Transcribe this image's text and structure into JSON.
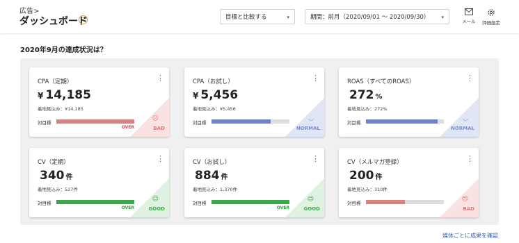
{
  "header": {
    "breadcrumb": "広告>",
    "title": "ダッシュボード",
    "help_icon": "?",
    "compare_select": "目標と比較する",
    "period_select": "期間：前月（2020/09/01 ～ 2020/09/30）",
    "select_arrow": "▾",
    "mail_label": "メール",
    "settings_label": "評価設定"
  },
  "section_title": "2020年9月の達成状況は？",
  "menu_glyph": "⋮",
  "target_label": "対目標",
  "cards": [
    {
      "title": "CPA（定期）",
      "prefix": "¥",
      "value": "14,185",
      "unit": "",
      "forecast": "着地見込み：¥14,185",
      "progress": 1.0,
      "bar_color": "#d98080",
      "bar_tag": "OVER",
      "bar_tag_color": "#d04a4a",
      "status": "BAD",
      "status_face": "☹",
      "status_color": "#d97a7a",
      "corner_color": "#fbe2e2"
    },
    {
      "title": "CPA（お試し）",
      "prefix": "¥",
      "value": "5,456",
      "unit": "",
      "forecast": "着地見込み：¥5,456",
      "progress": 0.76,
      "bar_color": "#6f86c6",
      "bar_tag": "",
      "bar_tag_color": "#6f86c6",
      "status": "NORMAL",
      "status_face": "◡",
      "status_color": "#7d90c8",
      "corner_color": "#e1e6f6"
    },
    {
      "title": "ROAS（すべてのROAS）",
      "prefix": "",
      "value": "272",
      "unit": "%",
      "forecast": "着地見込み：272%",
      "progress": 0.92,
      "bar_color": "#6f86c6",
      "bar_tag": "",
      "bar_tag_color": "#6f86c6",
      "status": "NORMAL",
      "status_face": "◡",
      "status_color": "#7d90c8",
      "corner_color": "#e1e6f6"
    },
    {
      "title": "CV（定期）",
      "prefix": "",
      "value": "340",
      "unit": "件",
      "forecast": "着地見込み：527件",
      "progress": 1.0,
      "bar_color": "#3aa84a",
      "bar_tag": "OVER",
      "bar_tag_color": "#2e9a3e",
      "status": "GOOD",
      "status_face": "☺",
      "status_color": "#4aa655",
      "corner_color": "#dff1e0"
    },
    {
      "title": "CV（お試し）",
      "prefix": "",
      "value": "884",
      "unit": "件",
      "forecast": "着地見込み：1,370件",
      "progress": 1.0,
      "bar_color": "#3aa84a",
      "bar_tag": "OVER",
      "bar_tag_color": "#2e9a3e",
      "status": "GOOD",
      "status_face": "☺",
      "status_color": "#4aa655",
      "corner_color": "#dff1e0"
    },
    {
      "title": "CV（メルマガ登録）",
      "prefix": "",
      "value": "200",
      "unit": "件",
      "forecast": "着地見込み：310件",
      "progress": 0.5,
      "bar_color": "#d98080",
      "bar_tag": "",
      "bar_tag_color": "#d04a4a",
      "status": "BAD",
      "status_face": "☹",
      "status_color": "#d97a7a",
      "corner_color": "#fbe2e2"
    }
  ],
  "footer_link": "媒体ごとに成果を確認"
}
